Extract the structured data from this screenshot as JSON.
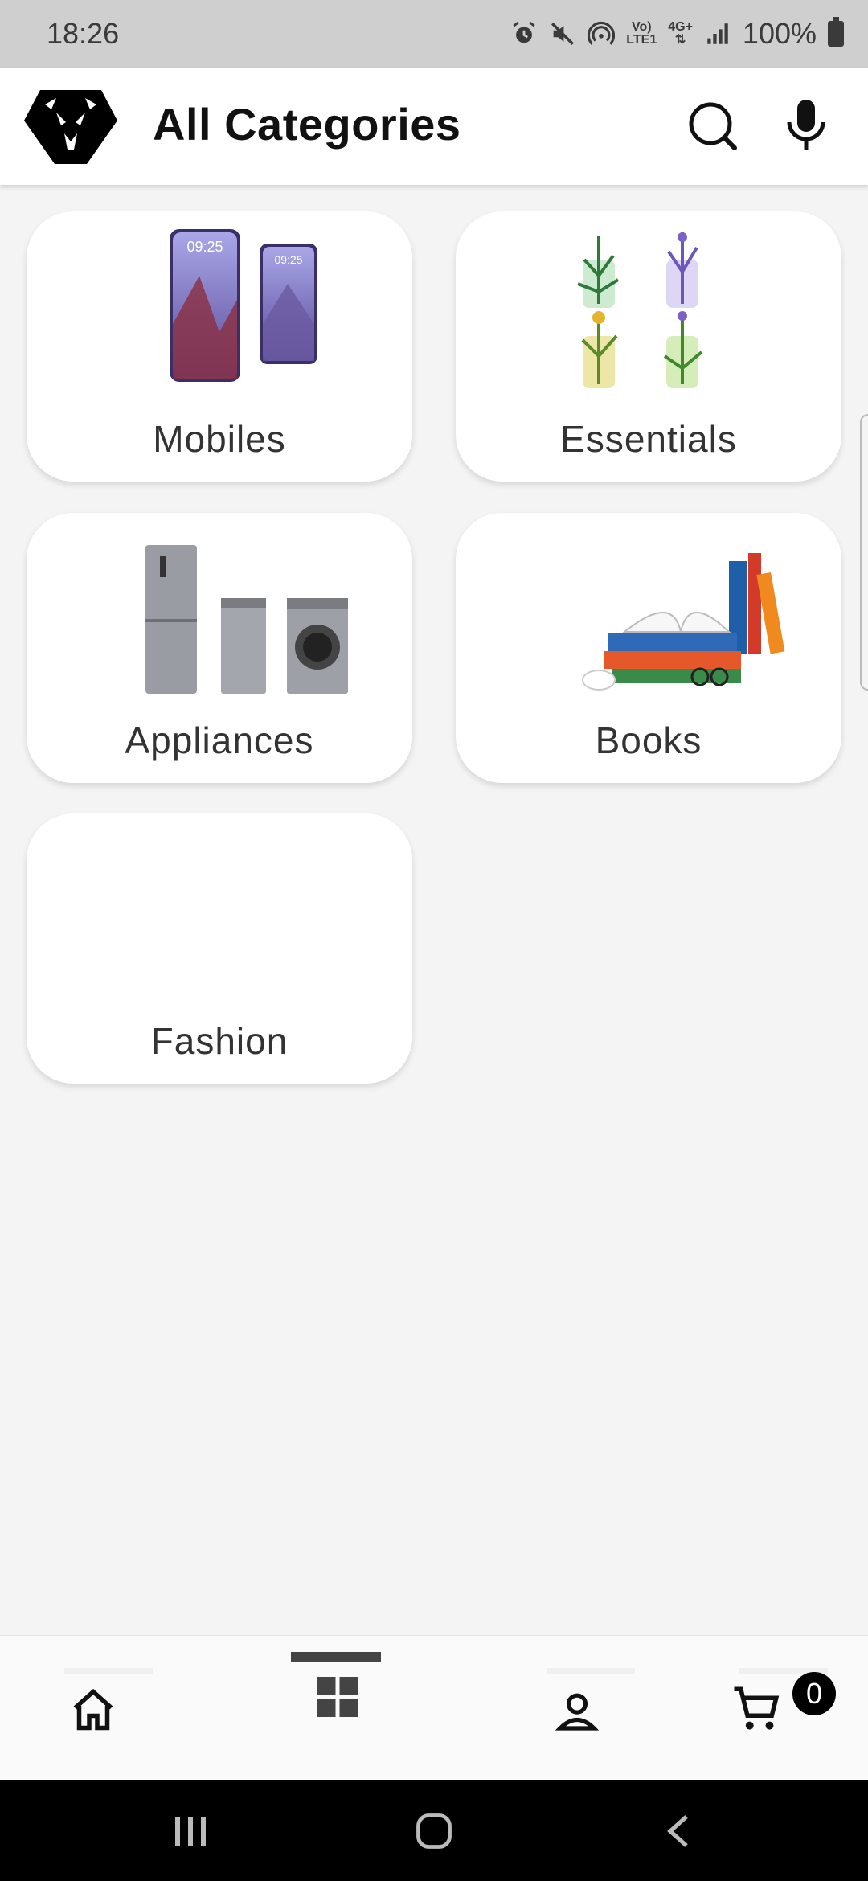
{
  "status_bar": {
    "time": "18:26",
    "network_top": "Vo)",
    "network_bottom": "LTE1",
    "data_top": "4G+",
    "battery": "100%"
  },
  "app_bar": {
    "title": "All Categories",
    "icons": [
      "lion-logo-icon",
      "search-icon",
      "mic-icon"
    ]
  },
  "categories": [
    {
      "label": "Mobiles",
      "image": "mobiles-image"
    },
    {
      "label": "Essentials",
      "image": "essentials-image"
    },
    {
      "label": "Appliances",
      "image": "appliances-image"
    },
    {
      "label": "Books",
      "image": "books-image"
    },
    {
      "label": "Fashion",
      "image": "fashion-image"
    }
  ],
  "bottom_nav": {
    "items": [
      "home-icon",
      "categories-icon",
      "account-icon",
      "cart-icon"
    ],
    "active": "categories-icon",
    "cart_count": "0"
  },
  "colors": {
    "background": "#f4f4f4",
    "card": "#ffffff",
    "status_bar": "#cfcfcf",
    "text": "#111111"
  }
}
